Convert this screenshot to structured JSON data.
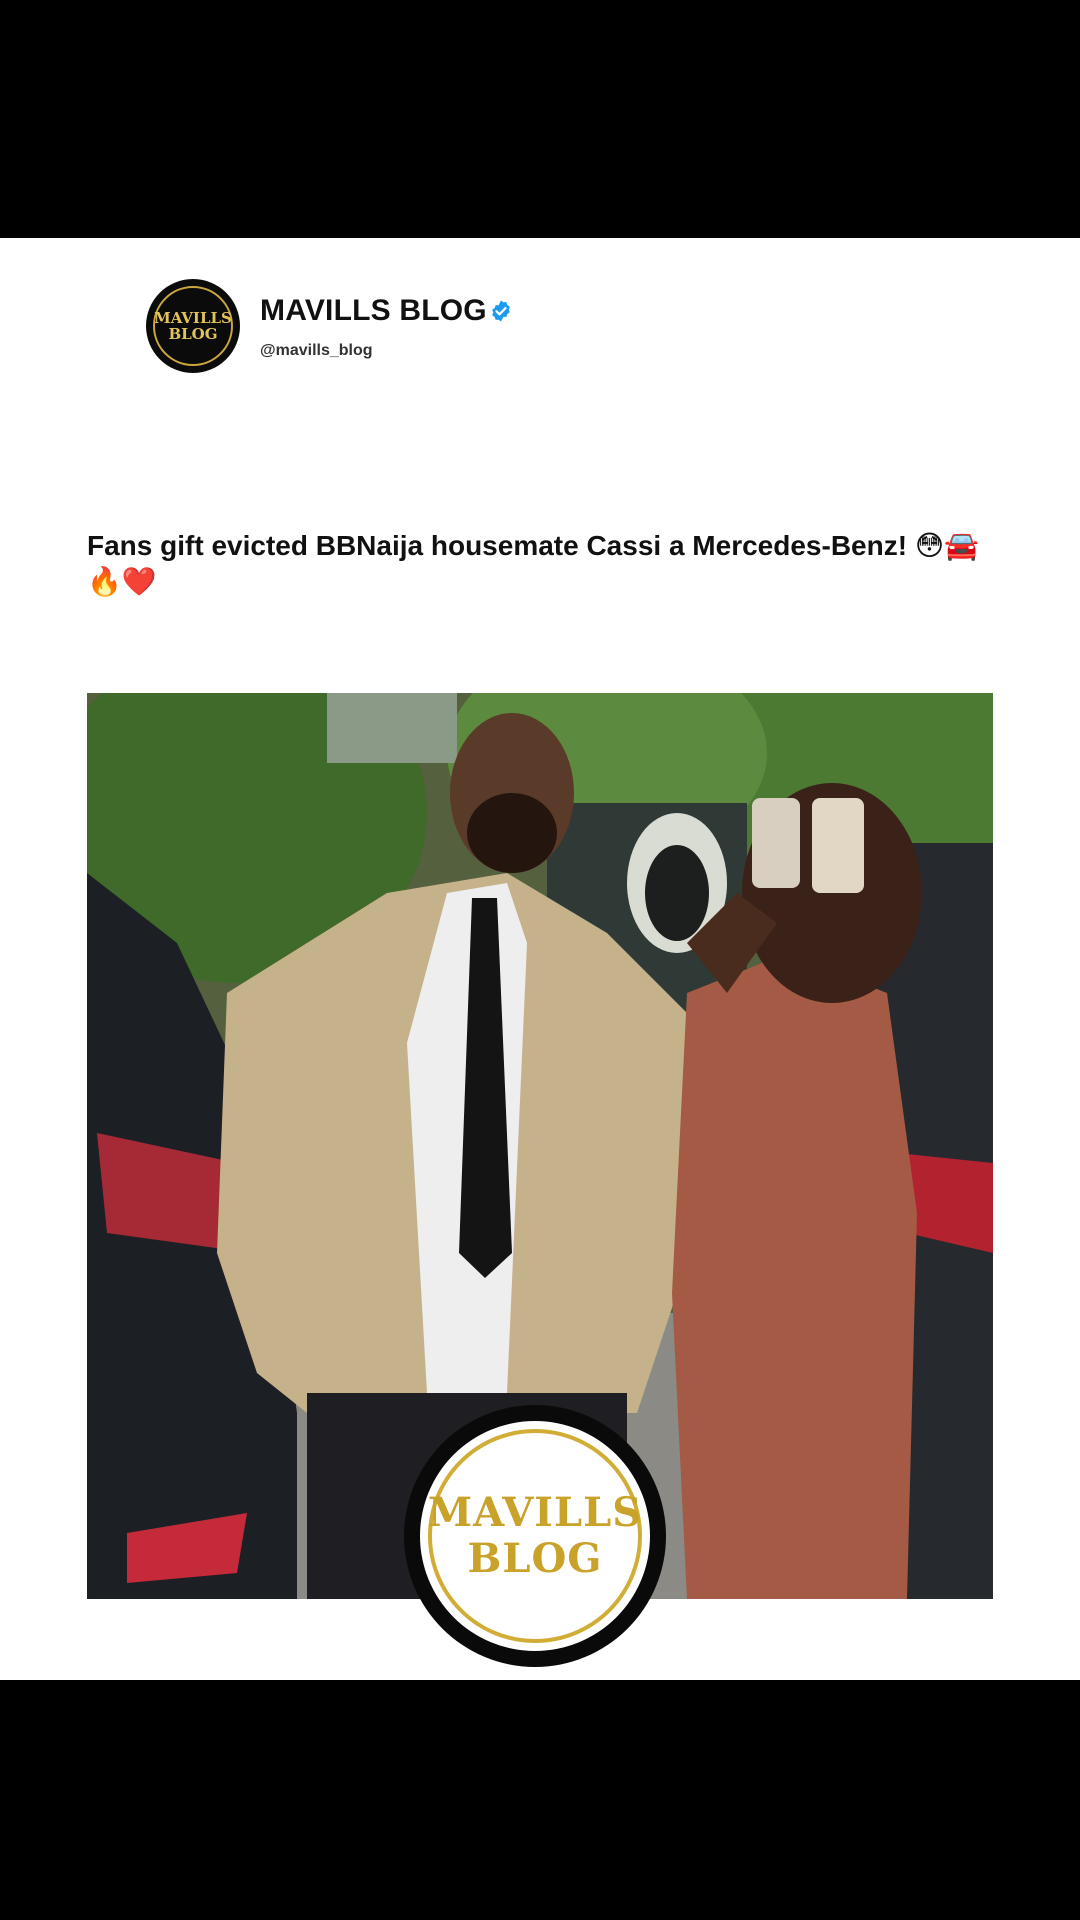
{
  "post": {
    "display_name": "MAVILLS BLOG",
    "handle": "@mavills_blog",
    "avatar_logo_line1": "MAVILLS",
    "avatar_logo_line2": "BLOG",
    "caption": "Fans gift evicted BBNaija housemate Cassi a Mercedes-Benz! 😳🚘🔥❤️"
  },
  "media": {
    "watermark_line1": "MAVILLS",
    "watermark_line2": "BLOG"
  },
  "colors": {
    "background": "#000000",
    "card": "#ffffff",
    "verified": "#1d9bf0",
    "logo_gold": "#d2ad36"
  },
  "icons": {
    "verified": "verified-badge-icon"
  }
}
